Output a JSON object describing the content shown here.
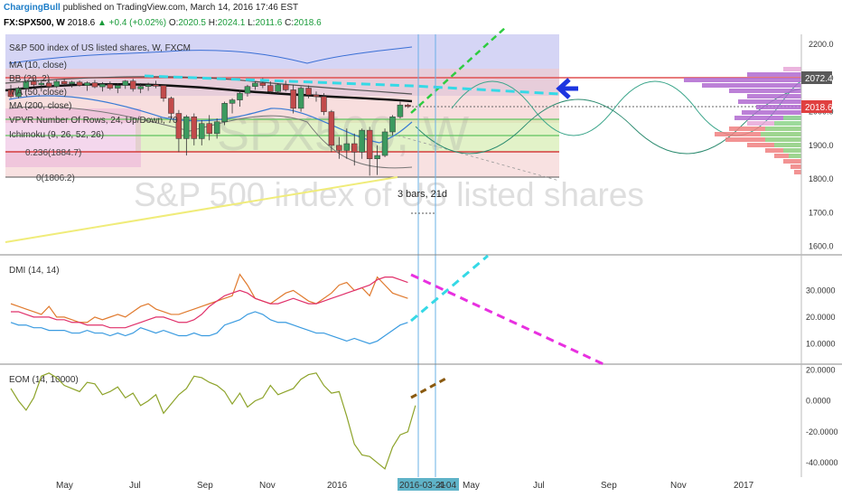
{
  "header": {
    "author": "ChargingBull",
    "published": "published on TradingView.com, March 14, 2016 17:46 EST",
    "symbol": "FX:SPX500, W",
    "last": "2018.6",
    "change": "+0.4 (+0.02%)",
    "o_label": "O:",
    "o_value": "2020.5",
    "h_label": "H:",
    "h_value": "2024.1",
    "l_label": "L:",
    "l_value": "2011.6",
    "c_label": "C:",
    "c_value": "2018.6"
  },
  "legend": {
    "title": "S&P 500 index of US listed shares, W, FXCM",
    "ma10": "MA (10, close)",
    "bb": "BB (20, 2)",
    "ma50": "MA (50, close)",
    "ma200": "MA (200, close)",
    "vpvr": "VPVR Number Of Rows, 24, Up/Down, 70",
    "ichimoku": "Ichimoku (9, 26, 52, 26)",
    "fib0236": "0.236(1884.7)",
    "fib0": "0(1806.2)"
  },
  "watermark": "S&P 500 index of US listed shares",
  "watermark_symbol": "SPX500, W",
  "annotation": "3 bars, 21d",
  "price_badges": {
    "upper": "2072.4",
    "current": "2018.6"
  },
  "colors": {
    "up": "#3c9a5f",
    "down": "#c24b4b",
    "ma200": "#111111",
    "ichimoku": "#3a7bd5",
    "projection_green": "#2ecc40",
    "projection_cyan": "#35d9e6",
    "projection_magenta": "#e830e0",
    "arrow": "#1c35e0",
    "dmi_plus": "#3a9be0",
    "dmi_minus": "#e07a2e",
    "adx": "#e0306a",
    "eom": "#8da32a",
    "eom_projection": "#8a5a10",
    "badge_red": "#e04040",
    "badge_gray": "#5a5a5a"
  },
  "chart_data": [
    {
      "type": "candlestick",
      "title": "S&P 500 index of US listed shares, W, FXCM",
      "ylim": [
        1580,
        2230
      ],
      "yticks": [
        "2200.0",
        "2100.0",
        "2000.0",
        "1900.0",
        "1800.0",
        "1700.0",
        "1600.0"
      ],
      "ytick_values": [
        2200,
        2100,
        2000,
        1900,
        1800,
        1700,
        1600
      ],
      "x_labels": [
        "May",
        "Jul",
        "Sep",
        "Nov",
        "2016",
        "2016-03-21",
        "4-04",
        "May",
        "Jul",
        "Sep",
        "Nov",
        "2017"
      ],
      "fib_levels": [
        {
          "label": "0.236(1884.7)",
          "value": 1884.7
        },
        {
          "label": "0(1806.2)",
          "value": 1806.2
        }
      ],
      "candles": [
        {
          "o": 2065,
          "h": 2080,
          "l": 2040,
          "c": 2045
        },
        {
          "o": 2045,
          "h": 2075,
          "l": 2040,
          "c": 2070
        },
        {
          "o": 2070,
          "h": 2095,
          "l": 2060,
          "c": 2090
        },
        {
          "o": 2090,
          "h": 2100,
          "l": 2075,
          "c": 2080
        },
        {
          "o": 2080,
          "h": 2095,
          "l": 2060,
          "c": 2085
        },
        {
          "o": 2085,
          "h": 2092,
          "l": 2070,
          "c": 2075
        },
        {
          "o": 2075,
          "h": 2095,
          "l": 2070,
          "c": 2090
        },
        {
          "o": 2090,
          "h": 2098,
          "l": 2078,
          "c": 2083
        },
        {
          "o": 2083,
          "h": 2092,
          "l": 2072,
          "c": 2088
        },
        {
          "o": 2088,
          "h": 2093,
          "l": 2075,
          "c": 2078
        },
        {
          "o": 2078,
          "h": 2090,
          "l": 2062,
          "c": 2086
        },
        {
          "o": 2086,
          "h": 2094,
          "l": 2070,
          "c": 2074
        },
        {
          "o": 2074,
          "h": 2088,
          "l": 2060,
          "c": 2082
        },
        {
          "o": 2082,
          "h": 2090,
          "l": 2065,
          "c": 2070
        },
        {
          "o": 2070,
          "h": 2085,
          "l": 2055,
          "c": 2078
        },
        {
          "o": 2078,
          "h": 2094,
          "l": 2068,
          "c": 2091
        },
        {
          "o": 2091,
          "h": 2098,
          "l": 2060,
          "c": 2068
        },
        {
          "o": 2068,
          "h": 2085,
          "l": 2055,
          "c": 2075
        },
        {
          "o": 2075,
          "h": 2086,
          "l": 2062,
          "c": 2080
        },
        {
          "o": 2080,
          "h": 2092,
          "l": 2070,
          "c": 2078
        },
        {
          "o": 2078,
          "h": 2082,
          "l": 2030,
          "c": 2040
        },
        {
          "o": 2040,
          "h": 2045,
          "l": 1980,
          "c": 1995
        },
        {
          "o": 1995,
          "h": 2005,
          "l": 1880,
          "c": 1920
        },
        {
          "o": 1920,
          "h": 1990,
          "l": 1870,
          "c": 1985
        },
        {
          "o": 1985,
          "h": 1995,
          "l": 1900,
          "c": 1920
        },
        {
          "o": 1920,
          "h": 1975,
          "l": 1900,
          "c": 1965
        },
        {
          "o": 1965,
          "h": 1990,
          "l": 1915,
          "c": 1935
        },
        {
          "o": 1935,
          "h": 1980,
          "l": 1920,
          "c": 1970
        },
        {
          "o": 1970,
          "h": 2030,
          "l": 1960,
          "c": 2025
        },
        {
          "o": 2025,
          "h": 2040,
          "l": 1995,
          "c": 2035
        },
        {
          "o": 2035,
          "h": 2065,
          "l": 2015,
          "c": 2055
        },
        {
          "o": 2055,
          "h": 2080,
          "l": 2045,
          "c": 2075
        },
        {
          "o": 2075,
          "h": 2090,
          "l": 2065,
          "c": 2085
        },
        {
          "o": 2085,
          "h": 2100,
          "l": 2070,
          "c": 2078
        },
        {
          "o": 2078,
          "h": 2090,
          "l": 2055,
          "c": 2060
        },
        {
          "o": 2060,
          "h": 2085,
          "l": 2050,
          "c": 2080
        },
        {
          "o": 2080,
          "h": 2092,
          "l": 2060,
          "c": 2065
        },
        {
          "o": 2065,
          "h": 2080,
          "l": 1995,
          "c": 2010
        },
        {
          "o": 2010,
          "h": 2075,
          "l": 2000,
          "c": 2070
        },
        {
          "o": 2070,
          "h": 2078,
          "l": 2040,
          "c": 2050
        },
        {
          "o": 2050,
          "h": 2060,
          "l": 2030,
          "c": 2045
        },
        {
          "o": 2045,
          "h": 2055,
          "l": 1990,
          "c": 2000
        },
        {
          "o": 2000,
          "h": 2005,
          "l": 1880,
          "c": 1900
        },
        {
          "o": 1900,
          "h": 1925,
          "l": 1860,
          "c": 1885
        },
        {
          "o": 1885,
          "h": 1950,
          "l": 1860,
          "c": 1905
        },
        {
          "o": 1905,
          "h": 1935,
          "l": 1840,
          "c": 1880
        },
        {
          "o": 1880,
          "h": 1950,
          "l": 1860,
          "c": 1945
        },
        {
          "o": 1945,
          "h": 1955,
          "l": 1810,
          "c": 1860
        },
        {
          "o": 1860,
          "h": 1900,
          "l": 1812,
          "c": 1870
        },
        {
          "o": 1870,
          "h": 1950,
          "l": 1865,
          "c": 1940
        },
        {
          "o": 1940,
          "h": 1990,
          "l": 1930,
          "c": 1985
        },
        {
          "o": 1985,
          "h": 2030,
          "l": 1980,
          "c": 2020
        },
        {
          "o": 2020,
          "h": 2024,
          "l": 2011,
          "c": 2018
        }
      ]
    },
    {
      "type": "line",
      "title": "DMI (14, 14)",
      "ylim": [
        3,
        42
      ],
      "yticks": [
        "30.0000",
        "20.0000",
        "10.0000"
      ],
      "ytick_values": [
        30,
        20,
        10
      ],
      "series": [
        {
          "name": "+DI",
          "values": [
            18,
            17,
            17,
            16,
            16,
            15,
            15,
            15,
            14,
            14,
            15,
            14,
            14,
            13,
            14,
            13,
            14,
            16,
            15,
            14,
            15,
            14,
            13,
            13,
            14,
            13,
            13,
            14,
            17,
            18,
            19,
            21,
            22,
            21,
            19,
            18,
            18,
            17,
            16,
            15,
            14,
            14,
            13,
            12,
            11,
            12,
            11,
            10,
            11,
            13,
            15,
            17,
            18
          ]
        },
        {
          "name": "-DI",
          "values": [
            25,
            24,
            23,
            22,
            21,
            24,
            20,
            20,
            19,
            18,
            18,
            20,
            19,
            20,
            21,
            20,
            22,
            24,
            25,
            23,
            22,
            21,
            21,
            22,
            23,
            24,
            25,
            26,
            27,
            28,
            36,
            32,
            27,
            26,
            25,
            27,
            29,
            30,
            28,
            26,
            25,
            27,
            29,
            32,
            33,
            30,
            31,
            28,
            35,
            32,
            29,
            28,
            27
          ]
        },
        {
          "name": "ADX",
          "values": [
            22,
            22,
            21,
            20,
            20,
            20,
            19,
            19,
            18,
            18,
            17,
            17,
            17,
            16,
            16,
            16,
            17,
            18,
            19,
            20,
            20,
            19,
            18,
            18,
            19,
            21,
            24,
            26,
            28,
            29,
            30,
            29,
            27,
            26,
            25,
            25,
            26,
            27,
            26,
            25,
            25,
            26,
            27,
            28,
            29,
            30,
            31,
            32,
            34,
            35,
            35,
            34,
            33
          ]
        }
      ]
    },
    {
      "type": "line",
      "title": "EOM (14, 10000)",
      "ylim": [
        -47,
        22
      ],
      "yticks": [
        "20.0000",
        "0.0000",
        "-20.0000",
        "-40.0000"
      ],
      "ytick_values": [
        20,
        0,
        -20,
        -40
      ],
      "series": [
        {
          "name": "EOM",
          "values": [
            8,
            0,
            -6,
            2,
            16,
            18,
            15,
            10,
            8,
            6,
            12,
            11,
            4,
            6,
            9,
            2,
            5,
            -3,
            0,
            4,
            -8,
            -2,
            4,
            8,
            16,
            15,
            12,
            10,
            6,
            -2,
            5,
            -4,
            0,
            2,
            10,
            4,
            6,
            8,
            14,
            17,
            18,
            10,
            5,
            6,
            -10,
            -28,
            -35,
            -36,
            -40,
            -44,
            -30,
            -22,
            -20,
            -3
          ]
        }
      ]
    }
  ]
}
